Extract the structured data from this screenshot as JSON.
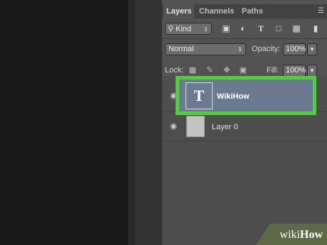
{
  "tabs": [
    "Layers",
    "Channels",
    "Paths"
  ],
  "filter": {
    "kind_label": "Kind",
    "kind_icon": "search-icon"
  },
  "filter_icons": [
    "image-filter-icon",
    "adjustment-filter-icon",
    "type-filter-icon",
    "shape-filter-icon",
    "smart-object-filter-icon"
  ],
  "blend": {
    "mode": "Normal",
    "opacity_label": "Opacity:",
    "opacity_value": "100%"
  },
  "lock": {
    "label": "Lock:",
    "fill_label": "Fill:",
    "fill_value": "100%"
  },
  "layers": [
    {
      "name": "WikiHow",
      "type": "text",
      "selected": true
    },
    {
      "name": "Layer 0",
      "type": "raster",
      "selected": false
    }
  ],
  "thumb_glyph": "T",
  "watermark": {
    "prefix": "wiki",
    "suffix": "How"
  },
  "colors": {
    "highlight": "#4cd137",
    "selected_row": "#6b7a90",
    "panel": "#535353"
  }
}
